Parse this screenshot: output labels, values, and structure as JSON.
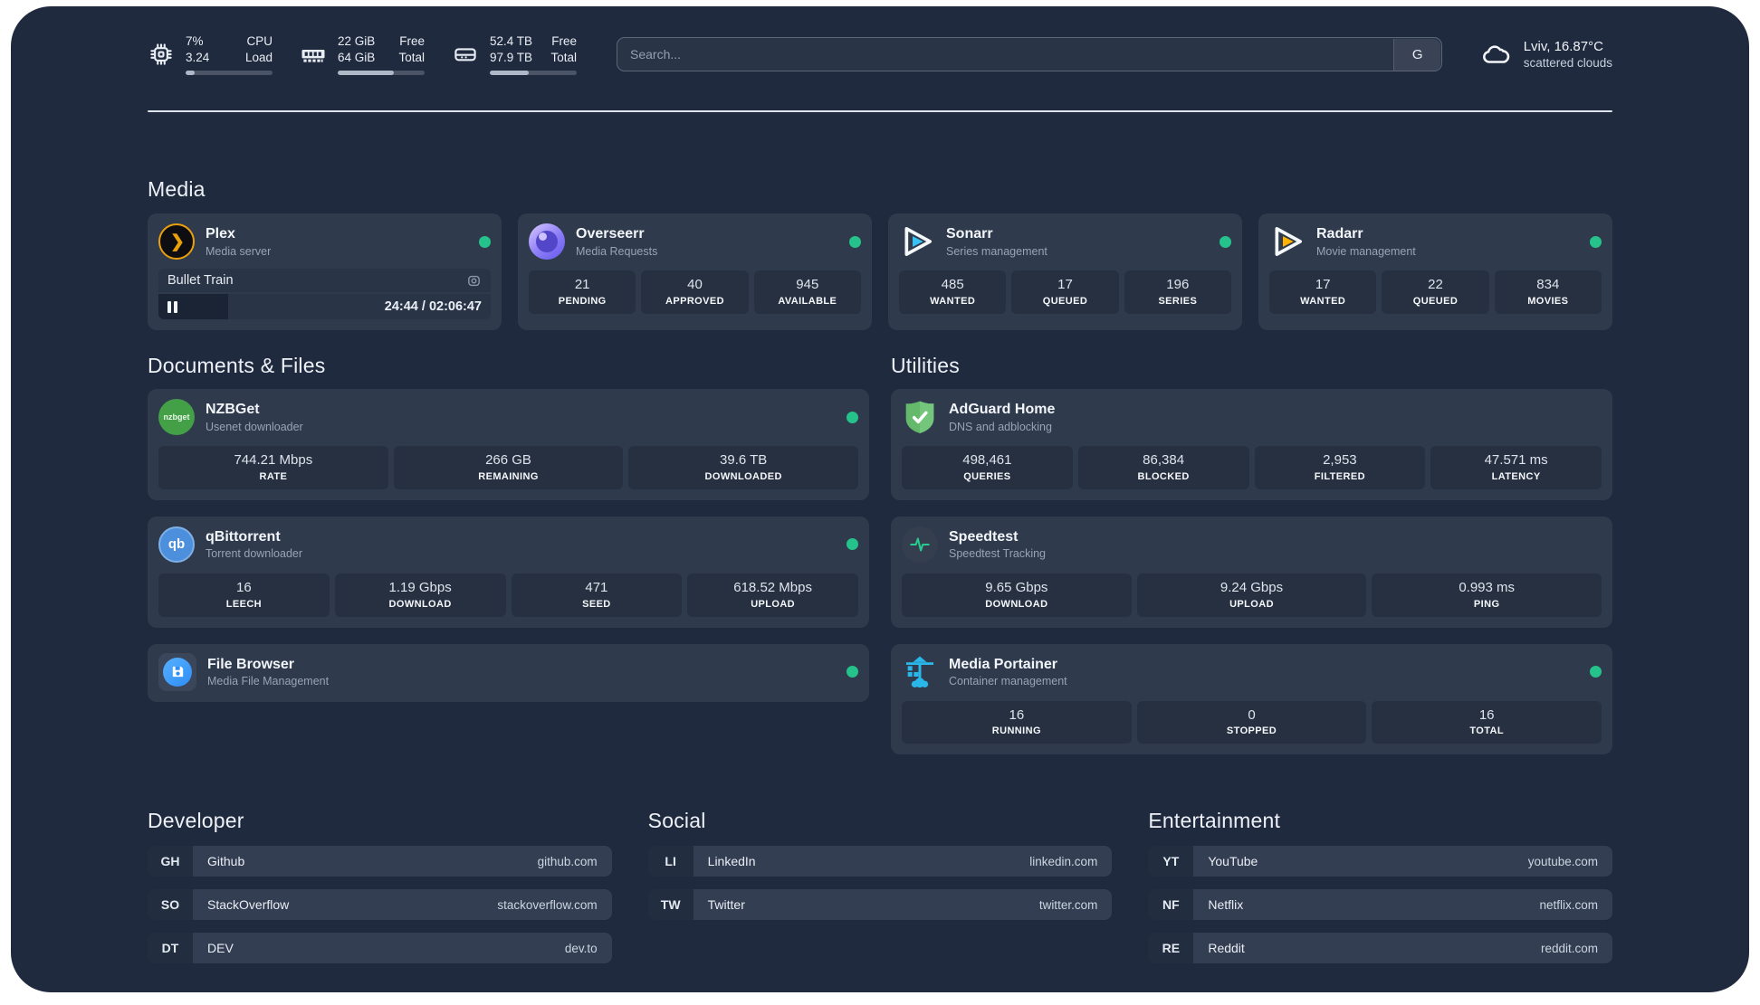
{
  "colors": {
    "status_online": "#25C38B",
    "plex_amber": "#E8A00C",
    "sonarr_blue": "#38C1F2",
    "radarr_amber": "#FFB300",
    "portainer_blue": "#29B6E8",
    "speedtest_green": "#27C98E",
    "adguard_green": "#64B96B",
    "nzbget_green": "#43A047",
    "qbittorrent_blue": "#4B8FDD",
    "filebrowser_blue": "#2F8DF5"
  },
  "header": {
    "stats": [
      {
        "icon": "cpu-icon",
        "value_top": "7%",
        "value_bottom": "3.24",
        "label_top": "CPU",
        "label_bottom": "Load",
        "progress": 10
      },
      {
        "icon": "memory-icon",
        "value_top": "22 GiB",
        "value_bottom": "64 GiB",
        "label_top": "Free",
        "label_bottom": "Total",
        "progress": 65
      },
      {
        "icon": "disk-icon",
        "value_top": "52.4 TB",
        "value_bottom": "97.9 TB",
        "label_top": "Free",
        "label_bottom": "Total",
        "progress": 45
      }
    ],
    "search": {
      "placeholder": "Search...",
      "button": "G"
    },
    "weather": {
      "location_temp": "Lviv, 16.87°C",
      "condition": "scattered clouds"
    }
  },
  "sections": {
    "media": {
      "title": "Media",
      "cards": [
        {
          "name": "Plex",
          "subtitle": "Media server",
          "status": "online",
          "now_playing": {
            "title": "Bullet Train",
            "time": "24:44 / 02:06:47",
            "progress": 21
          }
        },
        {
          "name": "Overseerr",
          "subtitle": "Media Requests",
          "status": "online",
          "stats": [
            {
              "value": "21",
              "label": "PENDING"
            },
            {
              "value": "40",
              "label": "APPROVED"
            },
            {
              "value": "945",
              "label": "AVAILABLE"
            }
          ]
        },
        {
          "name": "Sonarr",
          "subtitle": "Series management",
          "status": "online",
          "stats": [
            {
              "value": "485",
              "label": "WANTED"
            },
            {
              "value": "17",
              "label": "QUEUED"
            },
            {
              "value": "196",
              "label": "SERIES"
            }
          ]
        },
        {
          "name": "Radarr",
          "subtitle": "Movie management",
          "status": "online",
          "stats": [
            {
              "value": "17",
              "label": "WANTED"
            },
            {
              "value": "22",
              "label": "QUEUED"
            },
            {
              "value": "834",
              "label": "MOVIES"
            }
          ]
        }
      ]
    },
    "documents": {
      "title": "Documents & Files",
      "cards": [
        {
          "name": "NZBGet",
          "subtitle": "Usenet downloader",
          "status": "online",
          "stats": [
            {
              "value": "744.21 Mbps",
              "label": "RATE"
            },
            {
              "value": "266 GB",
              "label": "REMAINING"
            },
            {
              "value": "39.6 TB",
              "label": "DOWNLOADED"
            }
          ]
        },
        {
          "name": "qBittorrent",
          "subtitle": "Torrent downloader",
          "status": "online",
          "stats": [
            {
              "value": "16",
              "label": "LEECH"
            },
            {
              "value": "1.19 Gbps",
              "label": "DOWNLOAD"
            },
            {
              "value": "471",
              "label": "SEED"
            },
            {
              "value": "618.52 Mbps",
              "label": "UPLOAD"
            }
          ]
        },
        {
          "name": "File Browser",
          "subtitle": "Media File Management",
          "status": "online",
          "stats": []
        }
      ]
    },
    "utilities": {
      "title": "Utilities",
      "cards": [
        {
          "name": "AdGuard Home",
          "subtitle": "DNS and adblocking",
          "stats": [
            {
              "value": "498,461",
              "label": "QUERIES"
            },
            {
              "value": "86,384",
              "label": "BLOCKED"
            },
            {
              "value": "2,953",
              "label": "FILTERED"
            },
            {
              "value": "47.571 ms",
              "label": "LATENCY"
            }
          ]
        },
        {
          "name": "Speedtest",
          "subtitle": "Speedtest Tracking",
          "stats": [
            {
              "value": "9.65 Gbps",
              "label": "DOWNLOAD"
            },
            {
              "value": "9.24 Gbps",
              "label": "UPLOAD"
            },
            {
              "value": "0.993 ms",
              "label": "PING"
            }
          ]
        },
        {
          "name": "Media Portainer",
          "subtitle": "Container management",
          "status": "online",
          "stats": [
            {
              "value": "16",
              "label": "RUNNING"
            },
            {
              "value": "0",
              "label": "STOPPED"
            },
            {
              "value": "16",
              "label": "TOTAL"
            }
          ]
        }
      ]
    },
    "developer": {
      "title": "Developer",
      "links": [
        {
          "abbr": "GH",
          "name": "Github",
          "url": "github.com"
        },
        {
          "abbr": "SO",
          "name": "StackOverflow",
          "url": "stackoverflow.com"
        },
        {
          "abbr": "DT",
          "name": "DEV",
          "url": "dev.to"
        }
      ]
    },
    "social": {
      "title": "Social",
      "links": [
        {
          "abbr": "LI",
          "name": "LinkedIn",
          "url": "linkedin.com"
        },
        {
          "abbr": "TW",
          "name": "Twitter",
          "url": "twitter.com"
        }
      ]
    },
    "entertainment": {
      "title": "Entertainment",
      "links": [
        {
          "abbr": "YT",
          "name": "YouTube",
          "url": "youtube.com"
        },
        {
          "abbr": "NF",
          "name": "Netflix",
          "url": "netflix.com"
        },
        {
          "abbr": "RE",
          "name": "Reddit",
          "url": "reddit.com"
        }
      ]
    }
  }
}
